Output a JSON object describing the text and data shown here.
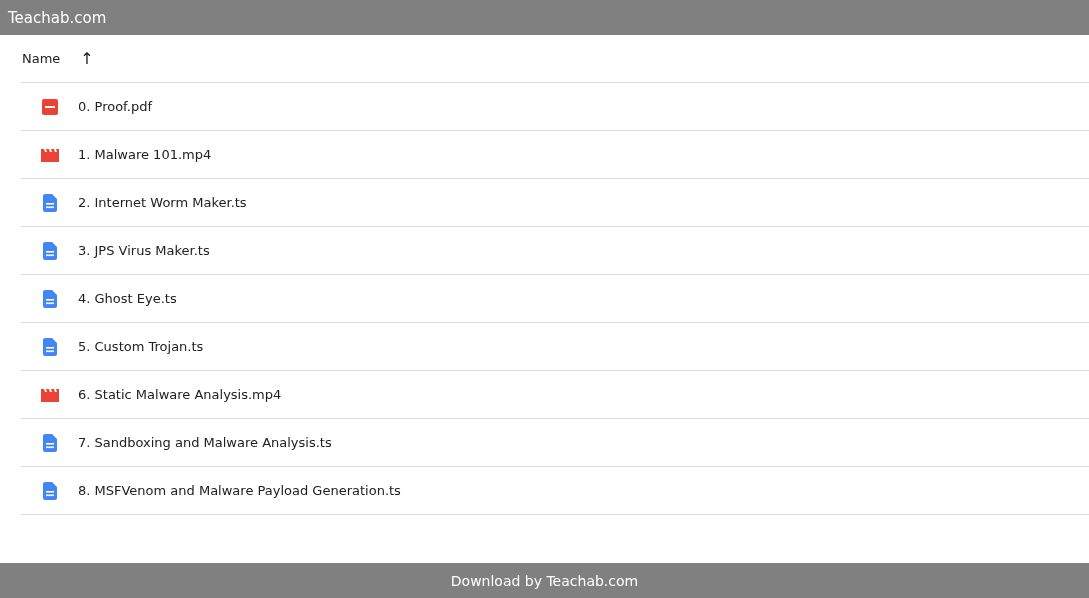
{
  "header": {
    "title": "Teachab.com"
  },
  "table": {
    "columns": [
      {
        "label": "Name",
        "sort_icon": "↑"
      }
    ],
    "rows": [
      {
        "kind": "pdf",
        "name": "0. Proof.pdf"
      },
      {
        "kind": "video",
        "name": "1. Malware 101.mp4"
      },
      {
        "kind": "doc",
        "name": "2. Internet Worm Maker.ts"
      },
      {
        "kind": "doc",
        "name": "3. JPS Virus Maker.ts"
      },
      {
        "kind": "doc",
        "name": "4. Ghost Eye.ts"
      },
      {
        "kind": "doc",
        "name": "5. Custom Trojan.ts"
      },
      {
        "kind": "video",
        "name": "6. Static Malware Analysis.mp4"
      },
      {
        "kind": "doc",
        "name": "7. Sandboxing and Malware Analysis.ts"
      },
      {
        "kind": "doc",
        "name": "8. MSFVenom and Malware Payload Generation.ts"
      }
    ]
  },
  "footer": {
    "text": "Download by Teachab.com"
  }
}
